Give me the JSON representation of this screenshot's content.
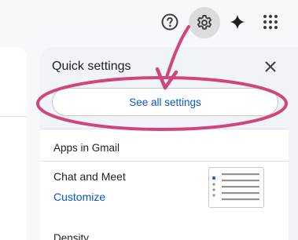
{
  "header": {
    "icons": [
      "help-icon",
      "settings-gear-icon",
      "gemini-spark-icon",
      "google-apps-icon"
    ]
  },
  "quick_settings": {
    "title": "Quick settings",
    "close_icon": "close-icon",
    "see_all_label": "See all settings",
    "apps_heading": "Apps in Gmail",
    "chat_meet_label": "Chat and Meet",
    "customize_label": "Customize",
    "density_label": "Density"
  },
  "colors": {
    "accent": "#0b57d0",
    "annotation": "#d0457a"
  }
}
